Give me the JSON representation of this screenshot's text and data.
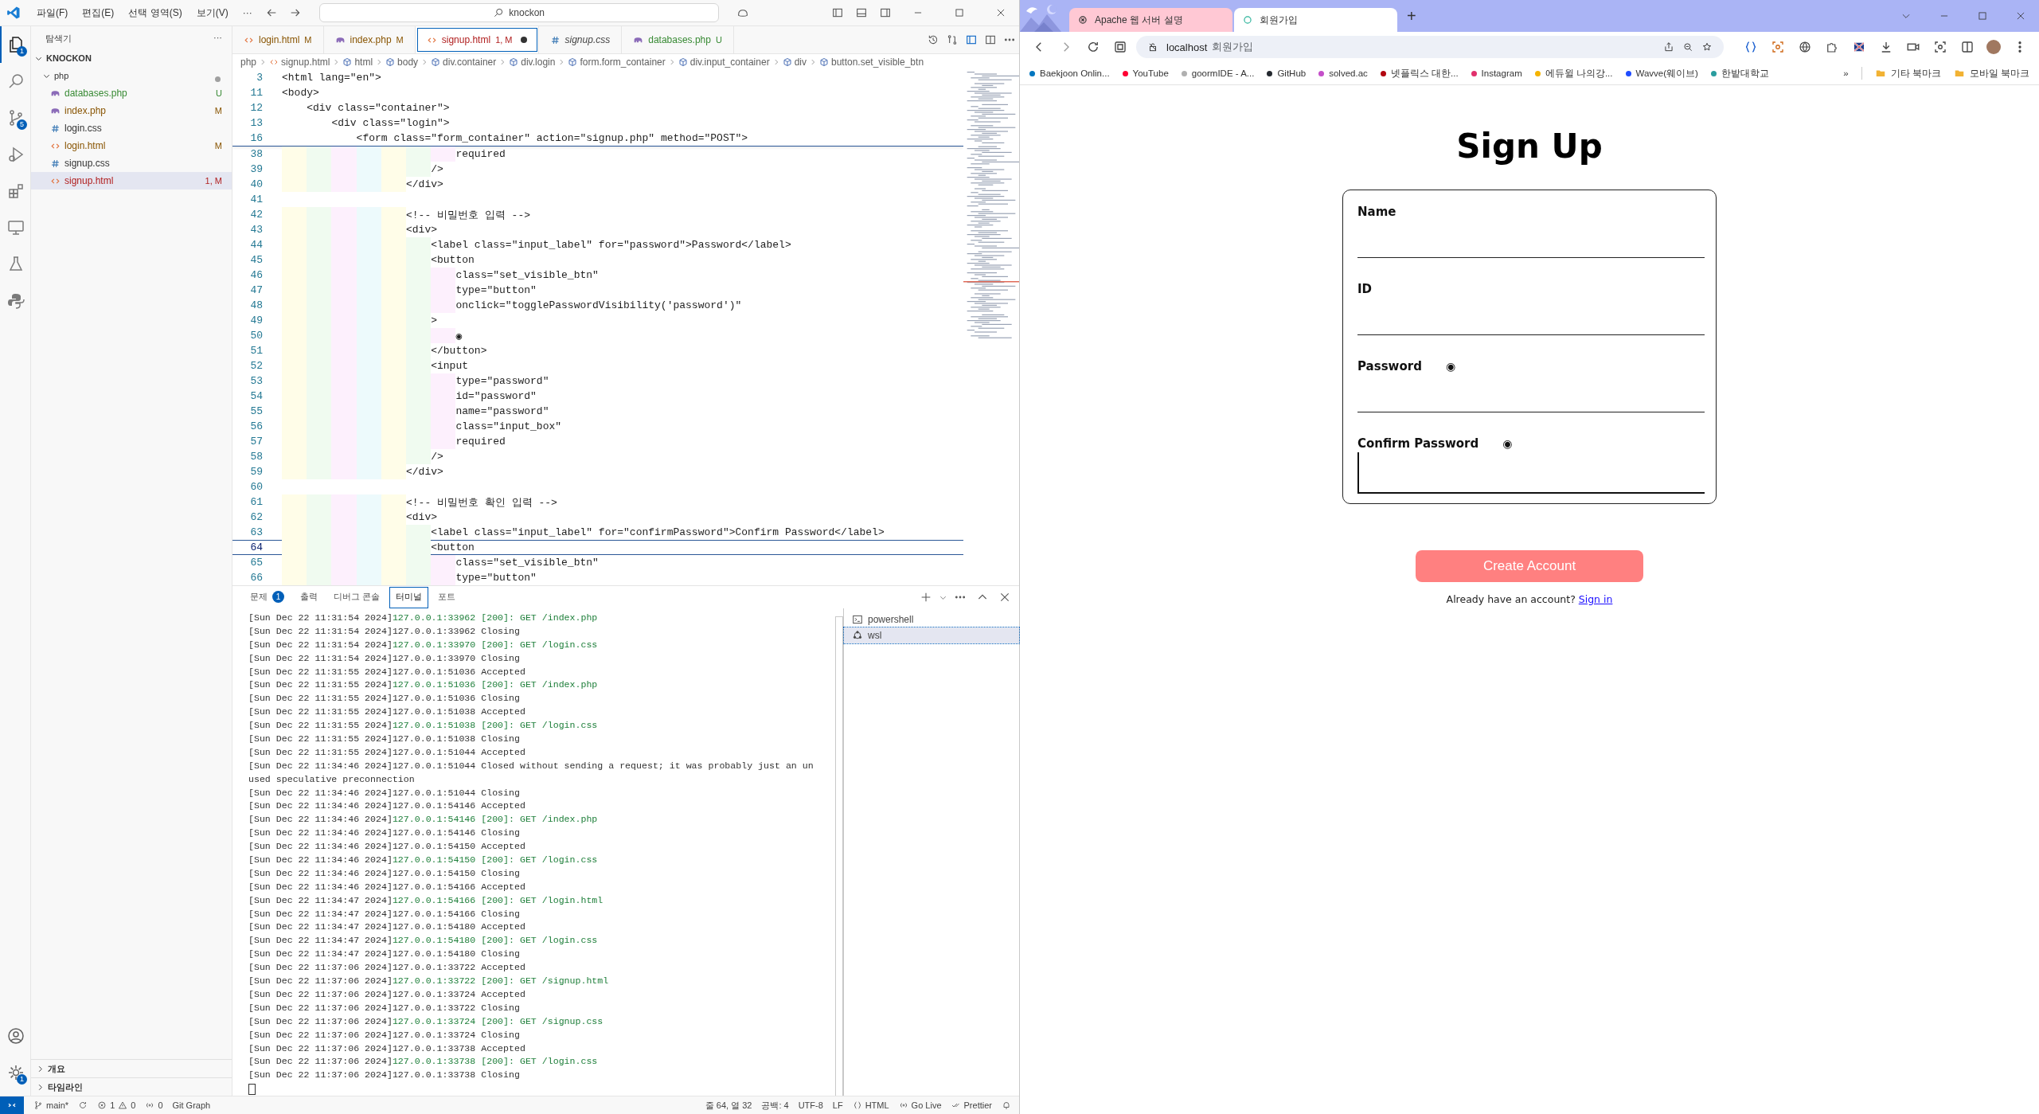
{
  "vscode": {
    "menus": [
      "파일(F)",
      "편집(E)",
      "선택 영역(S)",
      "보기(V)",
      "···"
    ],
    "command_center": "knockon",
    "activity_bar": [
      {
        "kind": "files",
        "selected": true,
        "badge": "1"
      },
      {
        "kind": "search",
        "selected": false
      },
      {
        "kind": "git",
        "selected": false,
        "badge": "5"
      },
      {
        "kind": "debug",
        "selected": false
      },
      {
        "kind": "extensions",
        "selected": false
      },
      {
        "kind": "remote",
        "selected": false
      },
      {
        "kind": "flask",
        "selected": false
      },
      {
        "kind": "python",
        "selected": false
      }
    ],
    "activity_bottom": [
      {
        "kind": "account"
      },
      {
        "kind": "gear",
        "badge": "1"
      }
    ],
    "explorer": {
      "title": "탐색기",
      "more": "···",
      "root": "KNOCKON",
      "folder": {
        "name": "php",
        "expanded": true,
        "has_changes": true
      },
      "files": [
        {
          "name": "databases.php",
          "kind": "php",
          "status": "U",
          "color": "#388a34",
          "selected": false
        },
        {
          "name": "index.php",
          "kind": "php",
          "status": "M",
          "color": "#895503",
          "selected": false
        },
        {
          "name": "login.css",
          "kind": "css",
          "selected": false
        },
        {
          "name": "login.html",
          "kind": "html",
          "status": "M",
          "color": "#895503",
          "selected": false
        },
        {
          "name": "signup.css",
          "kind": "css",
          "selected": false
        },
        {
          "name": "signup.html",
          "kind": "html",
          "status": "1, M",
          "color": "#b12020",
          "selected": true
        }
      ],
      "sections": [
        "개요",
        "타임라인"
      ]
    },
    "tabs": [
      {
        "label": "login.html",
        "kind": "html",
        "status": "M",
        "color": "#895503",
        "selected": false,
        "dirty": false,
        "preview": false
      },
      {
        "label": "index.php",
        "kind": "php",
        "status": "M",
        "color": "#895503",
        "selected": false,
        "dirty": false,
        "preview": false
      },
      {
        "label": "signup.html",
        "kind": "html",
        "status": "1, M",
        "color": "#b12020",
        "selected": true,
        "dirty": true,
        "preview": false
      },
      {
        "label": "signup.css",
        "kind": "css",
        "selected": false,
        "dirty": false,
        "preview": true
      },
      {
        "label": "databases.php",
        "kind": "php",
        "status": "U",
        "color": "#388a34",
        "selected": false,
        "dirty": false,
        "preview": false
      }
    ],
    "breadcrumb": [
      {
        "label": "php",
        "kind": "folder"
      },
      {
        "label": "signup.html",
        "kind": "file"
      },
      {
        "label": "html",
        "kind": "symbol"
      },
      {
        "label": "body",
        "kind": "symbol"
      },
      {
        "label": "div.container",
        "kind": "symbol"
      },
      {
        "label": "div.login",
        "kind": "symbol"
      },
      {
        "label": "form.form_container",
        "kind": "symbol"
      },
      {
        "label": "div.input_container",
        "kind": "symbol"
      },
      {
        "label": "div",
        "kind": "symbol"
      },
      {
        "label": "button.set_visible_btn",
        "kind": "symbol"
      }
    ],
    "editor": {
      "sticky": [
        {
          "num": "3",
          "text": "<html lang=\"en\">"
        },
        {
          "num": "11",
          "text": "<body>"
        },
        {
          "num": "12",
          "text": "    <div class=\"container\">"
        },
        {
          "num": "13",
          "text": "        <div class=\"login\">"
        },
        {
          "num": "16",
          "text": "            <form class=\"form_container\" action=\"signup.php\" method=\"POST\">"
        }
      ],
      "lines": [
        {
          "num": "38",
          "text": "                            required",
          "current": false
        },
        {
          "num": "39",
          "text": "                        />",
          "current": false
        },
        {
          "num": "40",
          "text": "                    </div>",
          "current": false
        },
        {
          "num": "41",
          "current": false
        },
        {
          "num": "42",
          "text": "                    <!-- 비밀번호 입력 -->",
          "current": false
        },
        {
          "num": "43",
          "text": "                    <div>",
          "current": false
        },
        {
          "num": "44",
          "text": "                        <label class=\"input_label\" for=\"password\">Password</label>",
          "current": false
        },
        {
          "num": "45",
          "text": "                        <button",
          "current": false
        },
        {
          "num": "46",
          "text": "                            class=\"set_visible_btn\"",
          "current": false
        },
        {
          "num": "47",
          "text": "                            type=\"button\"",
          "current": false
        },
        {
          "num": "48",
          "text": "                            onclick=\"togglePasswordVisibility('password')\"",
          "current": false
        },
        {
          "num": "49",
          "text": "                        >",
          "current": false
        },
        {
          "num": "50",
          "text": "                            ◉",
          "current": false
        },
        {
          "num": "51",
          "text": "                        </button>",
          "current": false
        },
        {
          "num": "52",
          "text": "                        <input",
          "current": false
        },
        {
          "num": "53",
          "text": "                            type=\"password\"",
          "current": false
        },
        {
          "num": "54",
          "text": "                            id=\"password\"",
          "current": false
        },
        {
          "num": "55",
          "text": "                            name=\"password\"",
          "current": false
        },
        {
          "num": "56",
          "text": "                            class=\"input_box\"",
          "current": false
        },
        {
          "num": "57",
          "text": "                            required",
          "current": false
        },
        {
          "num": "58",
          "text": "                        />",
          "current": false
        },
        {
          "num": "59",
          "text": "                    </div>",
          "current": false
        },
        {
          "num": "60",
          "current": false
        },
        {
          "num": "61",
          "text": "                    <!-- 비밀번호 확인 입력 -->",
          "current": false
        },
        {
          "num": "62",
          "text": "                    <div>",
          "current": false
        },
        {
          "num": "63",
          "text": "                        <label class=\"input_label\" for=\"confirmPassword\">Confirm Password</label>",
          "current": false
        },
        {
          "num": "64",
          "text": "                        <button",
          "current": true
        },
        {
          "num": "65",
          "text": "                            class=\"set_visible_btn\"",
          "current": false
        },
        {
          "num": "66",
          "text": "                            type=\"button\"",
          "current": false
        }
      ]
    },
    "panel": {
      "tabs": [
        {
          "label": "문제",
          "badge": "1",
          "selected": false
        },
        {
          "label": "출력",
          "selected": false
        },
        {
          "label": "디버그 콘솔",
          "selected": false
        },
        {
          "label": "터미널",
          "selected": true
        },
        {
          "label": "포트",
          "selected": false
        }
      ],
      "terminal_lines": [
        {
          "stamp": "[Sun Dec 22 11:31:54 2024]",
          "text": "127.0.0.1:33962 [200]: GET /index.php",
          "kind": "request"
        },
        {
          "stamp": "[Sun Dec 22 11:31:54 2024]",
          "text": "127.0.0.1:33962 Closing",
          "kind": "event"
        },
        {
          "stamp": "[Sun Dec 22 11:31:54 2024]",
          "text": "127.0.0.1:33970 [200]: GET /login.css",
          "kind": "request"
        },
        {
          "stamp": "[Sun Dec 22 11:31:54 2024]",
          "text": "127.0.0.1:33970 Closing",
          "kind": "event"
        },
        {
          "stamp": "[Sun Dec 22 11:31:55 2024]",
          "text": "127.0.0.1:51036 Accepted",
          "kind": "event"
        },
        {
          "stamp": "[Sun Dec 22 11:31:55 2024]",
          "text": "127.0.0.1:51036 [200]: GET /index.php",
          "kind": "request"
        },
        {
          "stamp": "[Sun Dec 22 11:31:55 2024]",
          "text": "127.0.0.1:51036 Closing",
          "kind": "event"
        },
        {
          "stamp": "[Sun Dec 22 11:31:55 2024]",
          "text": "127.0.0.1:51038 Accepted",
          "kind": "event"
        },
        {
          "stamp": "[Sun Dec 22 11:31:55 2024]",
          "text": "127.0.0.1:51038 [200]: GET /login.css",
          "kind": "request"
        },
        {
          "stamp": "[Sun Dec 22 11:31:55 2024]",
          "text": "127.0.0.1:51038 Closing",
          "kind": "event"
        },
        {
          "stamp": "[Sun Dec 22 11:31:55 2024]",
          "text": "127.0.0.1:51044 Accepted",
          "kind": "event"
        },
        {
          "stamp": "[Sun Dec 22 11:34:46 2024]",
          "text": "127.0.0.1:51044 Closed without sending a request; it was probably just an un",
          "kind": "event"
        },
        {
          "text": "used speculative preconnection",
          "kind": "event"
        },
        {
          "stamp": "[Sun Dec 22 11:34:46 2024]",
          "text": "127.0.0.1:51044 Closing",
          "kind": "event"
        },
        {
          "stamp": "[Sun Dec 22 11:34:46 2024]",
          "text": "127.0.0.1:54146 Accepted",
          "kind": "event"
        },
        {
          "stamp": "[Sun Dec 22 11:34:46 2024]",
          "text": "127.0.0.1:54146 [200]: GET /index.php",
          "kind": "request"
        },
        {
          "stamp": "[Sun Dec 22 11:34:46 2024]",
          "text": "127.0.0.1:54146 Closing",
          "kind": "event"
        },
        {
          "stamp": "[Sun Dec 22 11:34:46 2024]",
          "text": "127.0.0.1:54150 Accepted",
          "kind": "event"
        },
        {
          "stamp": "[Sun Dec 22 11:34:46 2024]",
          "text": "127.0.0.1:54150 [200]: GET /login.css",
          "kind": "request"
        },
        {
          "stamp": "[Sun Dec 22 11:34:46 2024]",
          "text": "127.0.0.1:54150 Closing",
          "kind": "event"
        },
        {
          "stamp": "[Sun Dec 22 11:34:46 2024]",
          "text": "127.0.0.1:54166 Accepted",
          "kind": "event"
        },
        {
          "stamp": "[Sun Dec 22 11:34:47 2024]",
          "text": "127.0.0.1:54166 [200]: GET /login.html",
          "kind": "request"
        },
        {
          "stamp": "[Sun Dec 22 11:34:47 2024]",
          "text": "127.0.0.1:54166 Closing",
          "kind": "event"
        },
        {
          "stamp": "[Sun Dec 22 11:34:47 2024]",
          "text": "127.0.0.1:54180 Accepted",
          "kind": "event"
        },
        {
          "stamp": "[Sun Dec 22 11:34:47 2024]",
          "text": "127.0.0.1:54180 [200]: GET /login.css",
          "kind": "request"
        },
        {
          "stamp": "[Sun Dec 22 11:34:47 2024]",
          "text": "127.0.0.1:54180 Closing",
          "kind": "event"
        },
        {
          "stamp": "[Sun Dec 22 11:37:06 2024]",
          "text": "127.0.0.1:33722 Accepted",
          "kind": "event"
        },
        {
          "stamp": "[Sun Dec 22 11:37:06 2024]",
          "text": "127.0.0.1:33722 [200]: GET /signup.html",
          "kind": "request"
        },
        {
          "stamp": "[Sun Dec 22 11:37:06 2024]",
          "text": "127.0.0.1:33724 Accepted",
          "kind": "event"
        },
        {
          "stamp": "[Sun Dec 22 11:37:06 2024]",
          "text": "127.0.0.1:33722 Closing",
          "kind": "event"
        },
        {
          "stamp": "[Sun Dec 22 11:37:06 2024]",
          "text": "127.0.0.1:33724 [200]: GET /signup.css",
          "kind": "request"
        },
        {
          "stamp": "[Sun Dec 22 11:37:06 2024]",
          "text": "127.0.0.1:33724 Closing",
          "kind": "event"
        },
        {
          "stamp": "[Sun Dec 22 11:37:06 2024]",
          "text": "127.0.0.1:33738 Accepted",
          "kind": "event"
        },
        {
          "stamp": "[Sun Dec 22 11:37:06 2024]",
          "text": "127.0.0.1:33738 [200]: GET /login.css",
          "kind": "request"
        },
        {
          "stamp": "[Sun Dec 22 11:37:06 2024]",
          "text": "127.0.0.1:33738 Closing",
          "kind": "event"
        }
      ],
      "terminals": [
        {
          "name": "powershell",
          "kind": "shell",
          "selected": false
        },
        {
          "name": "wsl",
          "kind": "linux",
          "selected": true
        }
      ]
    },
    "status_bar": {
      "branch": "main*",
      "errors": "1",
      "warnings": "0",
      "ports": "0",
      "git_graph": "Git Graph",
      "position": "줄 64, 열 32",
      "spaces": "공백: 4",
      "encoding": "UTF-8",
      "eol": "LF",
      "language": "HTML",
      "live": "Go Live",
      "formatter": "Prettier"
    }
  },
  "browser": {
    "tabs": [
      {
        "title": "Apache 웹 서버 설명",
        "kind": "chat",
        "selected": false
      },
      {
        "title": "회원가입",
        "kind": "loading",
        "selected": true
      }
    ],
    "new_tab": "+",
    "address": {
      "host": "localhost",
      "page_title": "회원가입"
    },
    "bookmarks": [
      {
        "label": "Baekjoon Onlin...",
        "color": "#0076c0"
      },
      {
        "label": "YouTube",
        "color": "#ff0033"
      },
      {
        "label": "goormIDE - A...",
        "color": "#b0b0b0"
      },
      {
        "label": "GitHub",
        "color": "#24292f"
      },
      {
        "label": "solved.ac",
        "color": "#c44fc9"
      },
      {
        "label": "넷플릭스 대한...",
        "color": "#b20710"
      },
      {
        "label": "Instagram",
        "color": "#e1306c"
      },
      {
        "label": "에듀윌 나의강...",
        "color": "#f5b400"
      },
      {
        "label": "Wavve(웨이브)",
        "color": "#1f4cff"
      },
      {
        "label": "한밭대학교",
        "color": "#2a9d9f"
      }
    ],
    "overflow": "»",
    "folders": [
      "기타 북마크",
      "모바일 북마크"
    ],
    "page": {
      "title": "Sign Up",
      "fields": [
        {
          "label": "Name",
          "focused": false
        },
        {
          "label": "ID",
          "focused": false
        },
        {
          "label": "Password",
          "toggle": "◉",
          "focused": false
        },
        {
          "label": "Confirm Password",
          "toggle": "◉",
          "focused": true
        }
      ],
      "button": "Create Account",
      "prompt": "Already have an account?",
      "link": "Sign in"
    }
  }
}
